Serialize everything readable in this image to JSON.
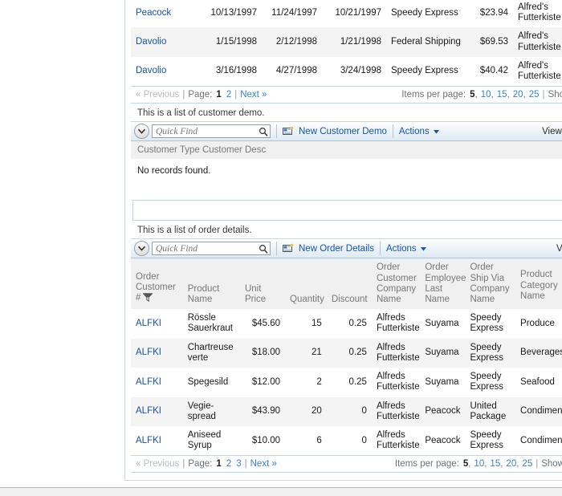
{
  "orders_grid": {
    "rows": [
      {
        "employee": "Peacock",
        "order_date": "10/13/1997",
        "required_date": "11/24/1997",
        "shipped_date": "10/21/1997",
        "ship_via": "Speedy Express",
        "freight": "$23.94",
        "customer": "Alfred's Futterkiste"
      },
      {
        "employee": "Davolio",
        "order_date": "1/15/1998",
        "required_date": "2/12/1998",
        "shipped_date": "1/21/1998",
        "ship_via": "Federal Shipping",
        "freight": "$69.53",
        "customer": "Alfred's Futterkiste"
      },
      {
        "employee": "Davolio",
        "order_date": "3/16/1998",
        "required_date": "4/27/1998",
        "shipped_date": "3/24/1998",
        "ship_via": "Speedy Express",
        "freight": "$40.42",
        "customer": "Alfred's Futterkiste"
      }
    ],
    "pager": {
      "previous": "« Previous",
      "page_label": "Page:",
      "pages": [
        "1",
        "2"
      ],
      "current_page": "1",
      "next": "Next »",
      "items_label": "Items per page:",
      "item_counts": [
        "5",
        "10",
        "15",
        "20",
        "25"
      ],
      "current_count": "5",
      "show_truncated": "Sho"
    }
  },
  "customer_demo": {
    "caption": "This is a list of customer demo.",
    "toolbar": {
      "quick_find_placeholder": "Quick Find",
      "quick_find_value": "",
      "new_label": "New Customer Demo",
      "actions_label": "Actions",
      "view_label": "View:"
    },
    "columns_text": "Customer Type Customer Desc",
    "no_records": "No records found."
  },
  "order_details": {
    "caption": "This is a list of order details.",
    "toolbar": {
      "quick_find_placeholder": "Quick Find",
      "quick_find_value": "",
      "new_label": "New Order Details",
      "actions_label": "Actions",
      "view_label": "Vi"
    },
    "columns": [
      "Order Customer #",
      "Product Name",
      "Unit Price",
      "Quantity",
      "Discount",
      "Order Customer Company Name",
      "Order Employee Last Name",
      "Order Ship Via Company Name",
      "Product Category Name"
    ],
    "rows": [
      {
        "customer_no": "ALFKI",
        "product": "Rössle Sauerkraut",
        "unit_price": "$45.60",
        "quantity": "15",
        "discount": "0.25",
        "company": "Alfreds Futterkiste",
        "employee": "Suyama",
        "ship_via": "Speedy Express",
        "category": "Produce"
      },
      {
        "customer_no": "ALFKI",
        "product": "Chartreuse verte",
        "unit_price": "$18.00",
        "quantity": "21",
        "discount": "0.25",
        "company": "Alfreds Futterkiste",
        "employee": "Suyama",
        "ship_via": "Speedy Express",
        "category": "Beverages"
      },
      {
        "customer_no": "ALFKI",
        "product": "Spegesild",
        "unit_price": "$12.00",
        "quantity": "2",
        "discount": "0.25",
        "company": "Alfreds Futterkiste",
        "employee": "Suyama",
        "ship_via": "Speedy Express",
        "category": "Seafood"
      },
      {
        "customer_no": "ALFKI",
        "product": "Vegie-spread",
        "unit_price": "$43.90",
        "quantity": "20",
        "discount": "0",
        "company": "Alfreds Futterkiste",
        "employee": "Peacock",
        "ship_via": "United Package",
        "category": "Condiments"
      },
      {
        "customer_no": "ALFKI",
        "product": "Aniseed Syrup",
        "unit_price": "$10.00",
        "quantity": "6",
        "discount": "0",
        "company": "Alfreds Futterkiste",
        "employee": "Peacock",
        "ship_via": "Speedy Express",
        "category": "Condiments"
      }
    ],
    "pager": {
      "previous": "« Previous",
      "page_label": "Page:",
      "pages": [
        "1",
        "2",
        "3"
      ],
      "current_page": "1",
      "next": "Next »",
      "items_label": "Items per page:",
      "item_counts": [
        "5",
        "10",
        "15",
        "20",
        "25"
      ],
      "current_count": "5",
      "show_truncated": "Show"
    }
  },
  "colors": {
    "link": "#1753a8",
    "pager_link": "#3c82c4",
    "header_bg": "#f0f0f0",
    "alt_row": "#f4f4f4",
    "panel_border": "#bcd8e8"
  }
}
